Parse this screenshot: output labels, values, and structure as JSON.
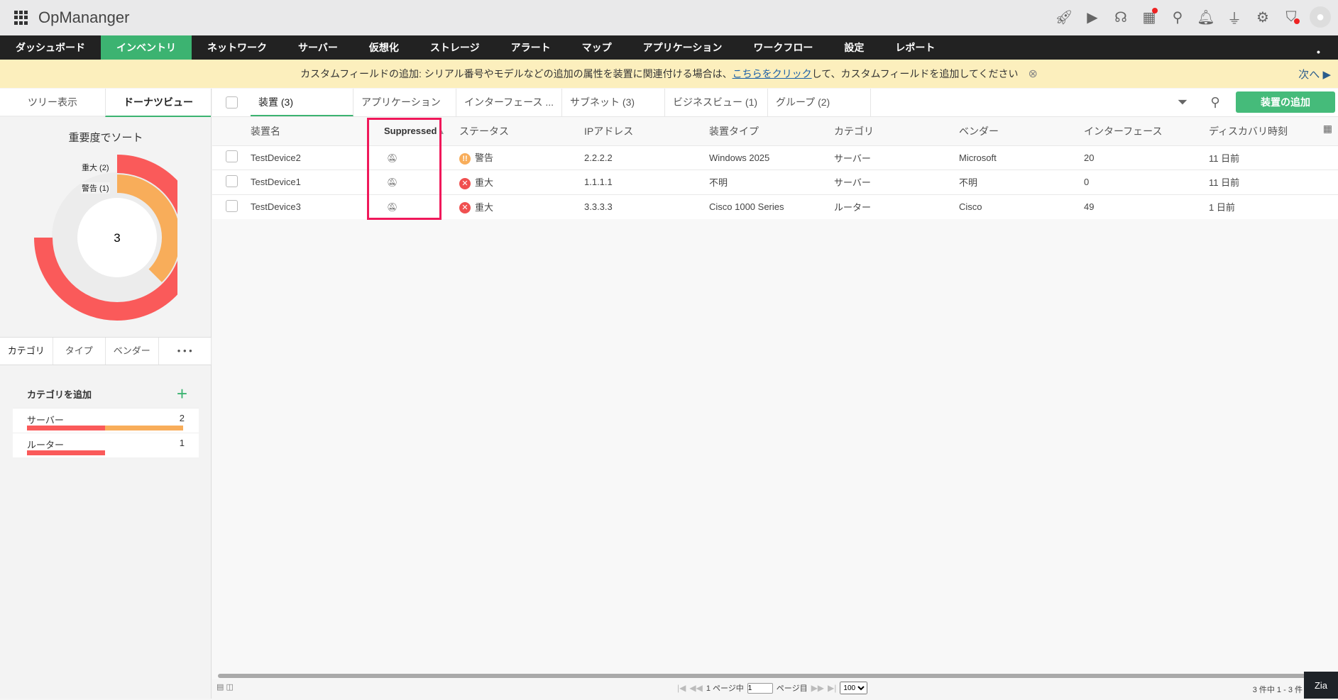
{
  "app": {
    "title": "OpMananger"
  },
  "top_icons": [
    "rocket-icon",
    "presentation-icon",
    "headset-icon",
    "gift-icon",
    "search-icon",
    "bell-icon",
    "plug-icon",
    "gear-icon",
    "shield-alert-icon",
    "user-avatar-icon"
  ],
  "nav": [
    "ダッシュボード",
    "インベントリ",
    "ネットワーク",
    "サーバー",
    "仮想化",
    "ストレージ",
    "アラート",
    "マップ",
    "アプリケーション",
    "ワークフロー",
    "設定",
    "レポート"
  ],
  "banner": {
    "text_before": "カスタムフィールドの追加: シリアル番号やモデルなどの追加の属性を装置に関連付ける場合は、",
    "link": "こちらをクリック",
    "text_after": "して、カスタムフィールドを追加してください",
    "next": "次へ"
  },
  "left": {
    "tabs": [
      "ツリー表示",
      "ドーナツビュー"
    ],
    "sort_title": "重要度でソート",
    "donut": {
      "center": "3",
      "rings": [
        {
          "label": "重大 (2)",
          "value": 2,
          "color": "#fa5a5a"
        },
        {
          "label": "警告 (1)",
          "value": 1,
          "color": "#f8ad5a"
        }
      ]
    },
    "bottom_tabs": [
      "カテゴリ",
      "タイプ",
      "ベンダー",
      "• • •"
    ],
    "add_category": "カテゴリを追加",
    "categories": [
      {
        "name": "サーバー",
        "count": "2",
        "critical": 1,
        "warning": 1
      },
      {
        "name": "ルーター",
        "count": "1",
        "critical": 1,
        "warning": 0
      }
    ]
  },
  "tabs": [
    "装置 (3)",
    "アプリケーション",
    "インターフェース ...",
    "サブネット (3)",
    "ビジネスビュー (1)",
    "グループ (2)"
  ],
  "add_device": "装置の追加",
  "table": {
    "headers": [
      "装置名",
      "Suppressed",
      "ステータス",
      "IPアドレス",
      "装置タイプ",
      "カテゴリ",
      "ベンダー",
      "インターフェース",
      "ディスカバリ時刻"
    ],
    "rows": [
      {
        "name": "TestDevice2",
        "status": "警告",
        "severity": "warning",
        "ip": "2.2.2.2",
        "type": "Windows 2025",
        "category": "サーバー",
        "vendor": "Microsoft",
        "interfaces": "20",
        "discovered": "11 日前"
      },
      {
        "name": "TestDevice1",
        "status": "重大",
        "severity": "critical",
        "ip": "1.1.1.1",
        "type": "不明",
        "category": "サーバー",
        "vendor": "不明",
        "interfaces": "0",
        "discovered": "11 日前"
      },
      {
        "name": "TestDevice3",
        "status": "重大",
        "severity": "critical",
        "ip": "3.3.3.3",
        "type": "Cisco 1000 Series",
        "category": "ルーター",
        "vendor": "Cisco",
        "interfaces": "49",
        "discovered": "1 日前"
      }
    ]
  },
  "footer": {
    "page_of": "1 ページ中",
    "page": "1",
    "page_suffix": "ページ目",
    "per_page": "100",
    "count": "3 件中 1 - 3 件",
    "zia": "Zia"
  }
}
